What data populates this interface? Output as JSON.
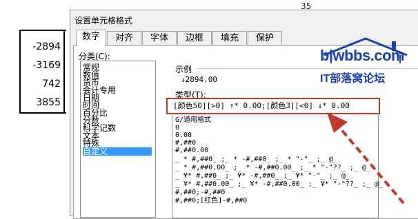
{
  "sheet": {
    "col_number": "35",
    "cells": [
      "-2894",
      "-3169",
      "742",
      "3855"
    ]
  },
  "dialog": {
    "title": "设置单元格格式",
    "tabs": [
      "数字",
      "对齐",
      "字体",
      "边框",
      "填充",
      "保护"
    ],
    "category_label": "分类(C):",
    "categories": [
      "常规",
      "数值",
      "货币",
      "会计专用",
      "日期",
      "时间",
      "百分比",
      "分数",
      "科学记数",
      "文本",
      "特殊",
      "自定义"
    ],
    "selected_category_index": 11,
    "sample_label": "示例",
    "sample_value": "↓2894.00",
    "type_label": "类型(T):",
    "type_value": "[颜色50][>0] ↑* 0.00;[颜色3][<0] ↓* 0.00",
    "format_list": [
      "G/通用格式",
      "0",
      "0.00",
      "#,##0",
      "#,##0.00",
      "_ * #,##0_ ;_ * -#,##0_ ;_ * \"-\"_ ;_ @_",
      "_ * #,##0.00_ ;_ * -#,##0.00_ ;_ * \"-\"??_ ;_ @_",
      "_ ¥* #,##0_ ;_ ¥* -#,##0_ ;_ ¥* \"-\"_ ;_ @_",
      "_ ¥* #,##0.00_ ;_ ¥* -#,##0.00_ ;_ ¥* \"-\"??_ ;_ @_",
      "#,##0;-#,##0",
      "#,##0;[红色]-#,##0"
    ]
  },
  "watermark": {
    "brand": "blwbbs.com",
    "subtitle": "IT部落窝论坛"
  },
  "colors": {
    "highlight": "#c0392b",
    "brand": "#1a3fb5",
    "selection": "#3399ff"
  }
}
